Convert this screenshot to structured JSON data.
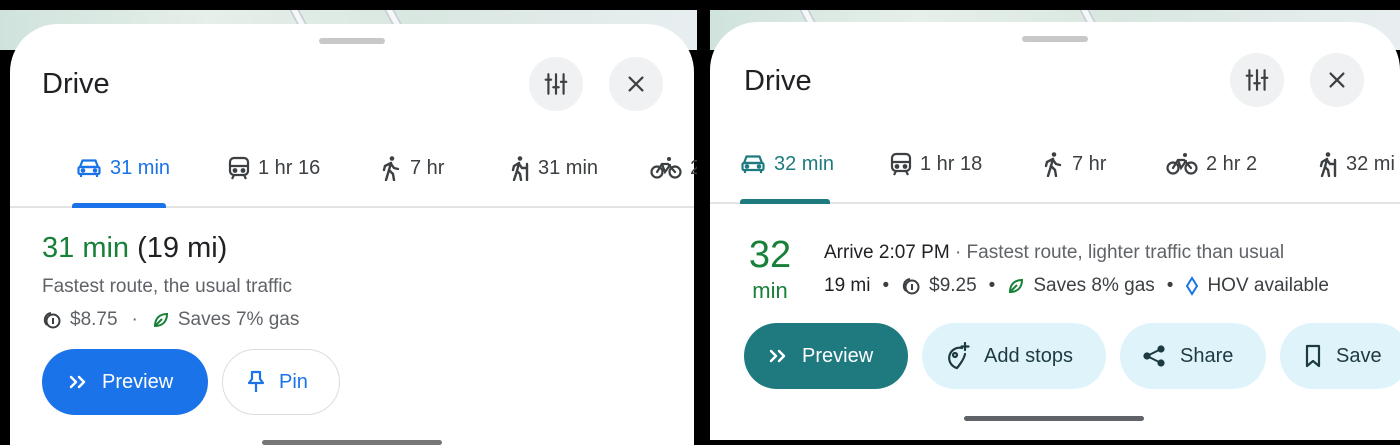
{
  "left": {
    "title": "Drive",
    "tabs": [
      {
        "icon": "car-icon",
        "label": "31 min",
        "selected": true
      },
      {
        "icon": "train-icon",
        "label": "1 hr 16",
        "selected": false
      },
      {
        "icon": "walk-icon",
        "label": "7 hr",
        "selected": false
      },
      {
        "icon": "wheelchair-hiker-icon",
        "label": "31 min",
        "selected": false
      },
      {
        "icon": "bike-icon",
        "label": "2",
        "selected": false
      }
    ],
    "route": {
      "duration": "31 min",
      "distance": "(19 mi)",
      "description": "Fastest route, the usual traffic",
      "toll": "$8.75",
      "separator": "·",
      "gas": "Saves 7% gas"
    },
    "buttons": {
      "preview": "Preview",
      "pin": "Pin"
    },
    "colors": {
      "accent": "#1a73e8",
      "duration": "#188038"
    }
  },
  "right": {
    "title": "Drive",
    "tabs": [
      {
        "icon": "car-icon",
        "label": "32 min",
        "selected": true
      },
      {
        "icon": "train-icon",
        "label": "1 hr 18",
        "selected": false
      },
      {
        "icon": "walk-icon",
        "label": "7 hr",
        "selected": false
      },
      {
        "icon": "bike-icon",
        "label": "2 hr 2",
        "selected": false
      },
      {
        "icon": "wheelchair-hiker-icon",
        "label": "32 mi",
        "selected": false
      }
    ],
    "route": {
      "duration_value": "32",
      "duration_unit": "min",
      "arrive": "Arrive 2:07 PM",
      "description": "· Fastest route, lighter traffic than usual",
      "distance": "19 mi",
      "toll": "$9.25",
      "gas": "Saves 8% gas",
      "hov": "HOV available",
      "separator": "•"
    },
    "buttons": {
      "preview": "Preview",
      "add_stops": "Add stops",
      "share": "Share",
      "save": "Save"
    },
    "colors": {
      "accent": "#1f7a80",
      "chip": "#dff4fa",
      "duration": "#188038"
    }
  }
}
